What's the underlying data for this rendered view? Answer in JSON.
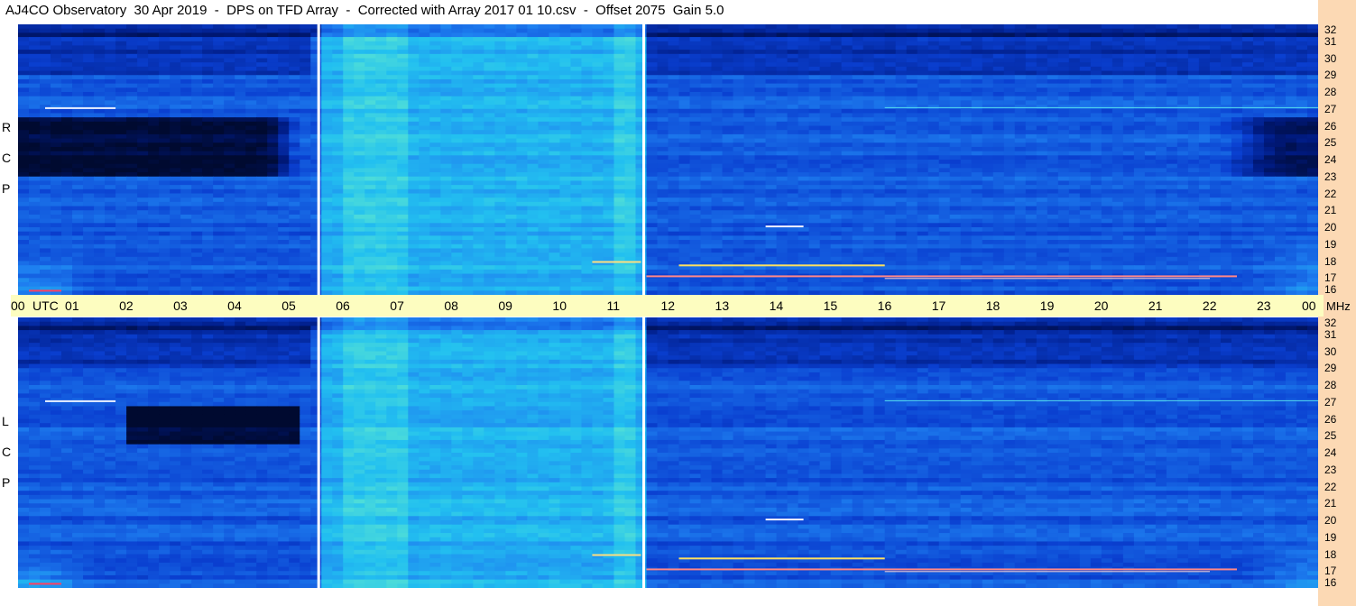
{
  "title": "AJ4CO Observatory  30 Apr 2019  -  DPS on TFD Array  -  Corrected with Array 2017 01 10.csv  -  Offset 2075  Gain 5.0",
  "colors": {
    "freq_band": "#fcd9b4",
    "time_band": "#fdfdc0",
    "divider": "#ffffff",
    "colormap": [
      "#000a30",
      "#001a80",
      "#0a3fd0",
      "#1e7ff0",
      "#22c0f0",
      "#5ee8d0",
      "#c8f060",
      "#ffe040",
      "#ff6040"
    ]
  },
  "chart_data": {
    "type": "heatmap",
    "time_axis": {
      "labels": [
        "00",
        "01",
        "02",
        "03",
        "04",
        "05",
        "06",
        "07",
        "08",
        "09",
        "10",
        "11",
        "12",
        "13",
        "14",
        "15",
        "16",
        "17",
        "18",
        "19",
        "20",
        "21",
        "22",
        "23",
        "00"
      ],
      "unit": "UTC"
    },
    "freq_axis": {
      "labels": [
        "32",
        "31",
        "30",
        "29",
        "28",
        "27",
        "26",
        "25",
        "24",
        "23",
        "22",
        "21",
        "20",
        "19",
        "18",
        "17",
        "16"
      ],
      "unit": "MHz"
    },
    "panels": [
      {
        "name": "RCP",
        "letters": [
          "R",
          "C",
          "P"
        ]
      },
      {
        "name": "LCP",
        "letters": [
          "L",
          "C",
          "P"
        ]
      }
    ],
    "divider_times_utc": [
      5.55,
      11.55
    ]
  }
}
